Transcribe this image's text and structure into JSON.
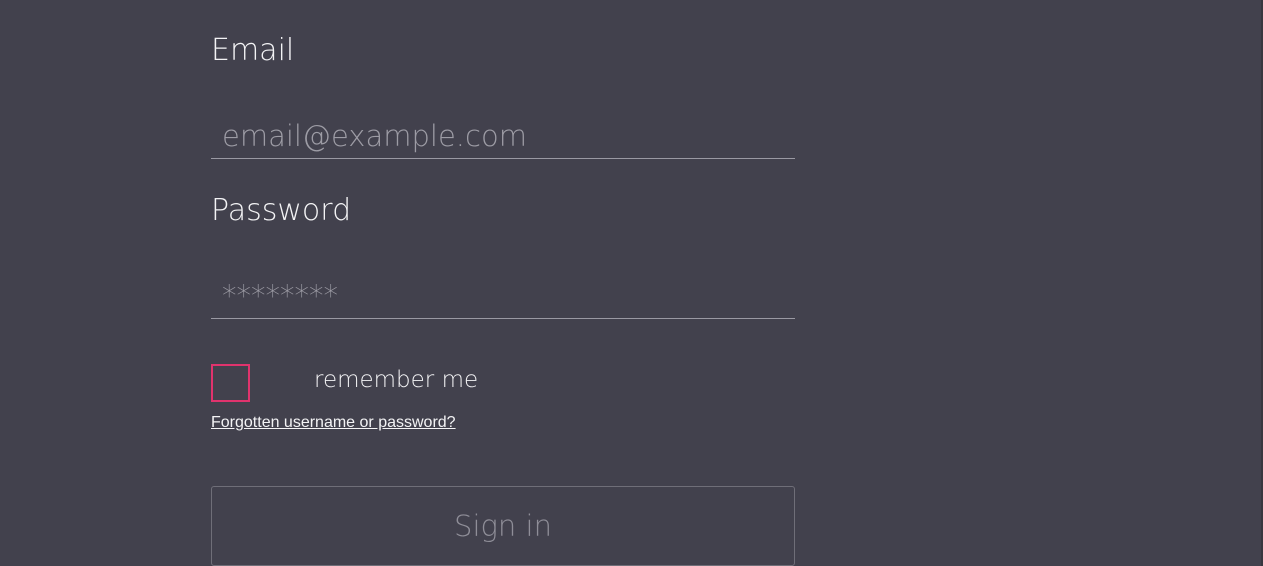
{
  "login_form": {
    "email": {
      "label": "Email",
      "placeholder": "email@example.com",
      "value": ""
    },
    "password": {
      "label": "Password",
      "placeholder": "********",
      "value": ""
    },
    "remember_me": {
      "label": "remember me",
      "checked": false
    },
    "forgot_link": "Forgotten username or password?",
    "submit_label": "Sign in"
  },
  "colors": {
    "background": "#42414d",
    "checkbox_accent": "#e0336d",
    "text": "#f3f3f5",
    "placeholder": "#9d9ca5"
  }
}
